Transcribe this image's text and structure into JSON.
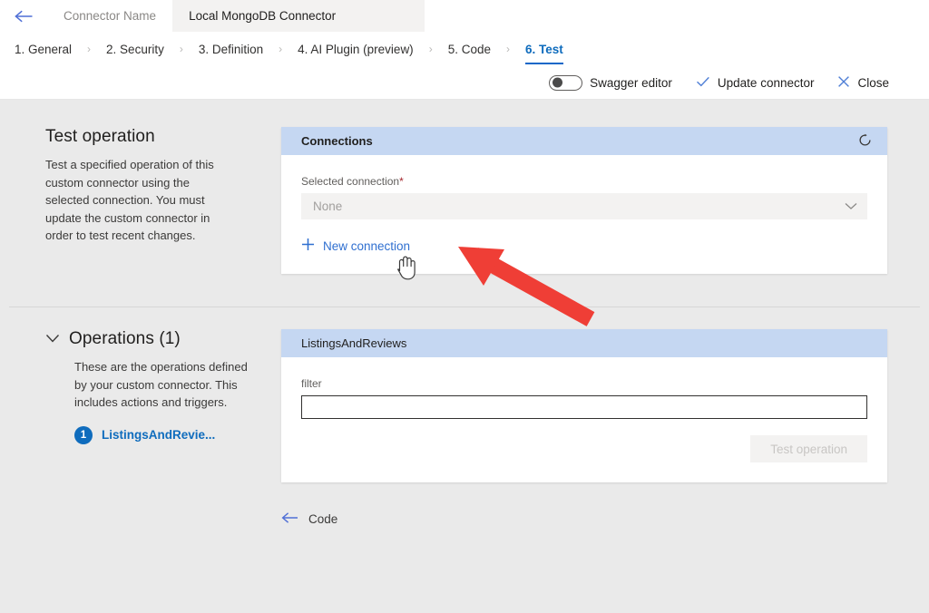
{
  "header": {
    "back_icon": "arrow-left-icon",
    "connector_name_label": "Connector Name",
    "connector_name_value": "Local MongoDB Connector"
  },
  "steps": [
    {
      "label": "1. General",
      "active": false
    },
    {
      "label": "2. Security",
      "active": false
    },
    {
      "label": "3. Definition",
      "active": false
    },
    {
      "label": "4. AI Plugin (preview)",
      "active": false
    },
    {
      "label": "5. Code",
      "active": false
    },
    {
      "label": "6. Test",
      "active": true
    }
  ],
  "step_separator": "›",
  "command_bar": {
    "swagger_toggle_label": "Swagger editor",
    "swagger_toggle_state": "off",
    "update_label": "Update connector",
    "update_icon": "checkmark-icon",
    "close_label": "Close",
    "close_icon": "close-icon"
  },
  "test_operation_section": {
    "title": "Test operation",
    "description": "Test a specified operation of this custom connector using the selected connection. You must update the custom connector in order to test recent changes."
  },
  "connections_card": {
    "title": "Connections",
    "refresh_icon": "refresh-icon",
    "selected_connection_label": "Selected connection",
    "required_marker": "*",
    "selected_connection_value": "None",
    "dropdown_icon": "chevron-down-icon",
    "new_connection_label": "New connection",
    "new_connection_icon": "plus-icon"
  },
  "operations_section": {
    "collapse_icon": "chevron-down-icon",
    "title": "Operations (1)",
    "description": "These are the operations defined by your custom connector. This includes actions and triggers.",
    "items": [
      {
        "badge": "1",
        "label": "ListingsAndRevie..."
      }
    ]
  },
  "operation_card": {
    "title": "ListingsAndReviews",
    "filter_label": "filter",
    "filter_value": "",
    "filter_placeholder": "",
    "test_button_label": "Test operation",
    "test_button_state": "disabled"
  },
  "footer": {
    "back_link_label": "Code",
    "back_link_icon": "arrow-left-icon"
  },
  "annotations": {
    "arrow_color": "#ef3e36",
    "arrow_name": "red-pointer-arrow",
    "cursor_name": "hand-cursor"
  },
  "colors": {
    "accent": "#0f6cbd",
    "card_header": "#c5d7f2",
    "page_background": "#eaeaea",
    "required_star": "#a4262c",
    "arrow_red": "#ef3e36"
  }
}
